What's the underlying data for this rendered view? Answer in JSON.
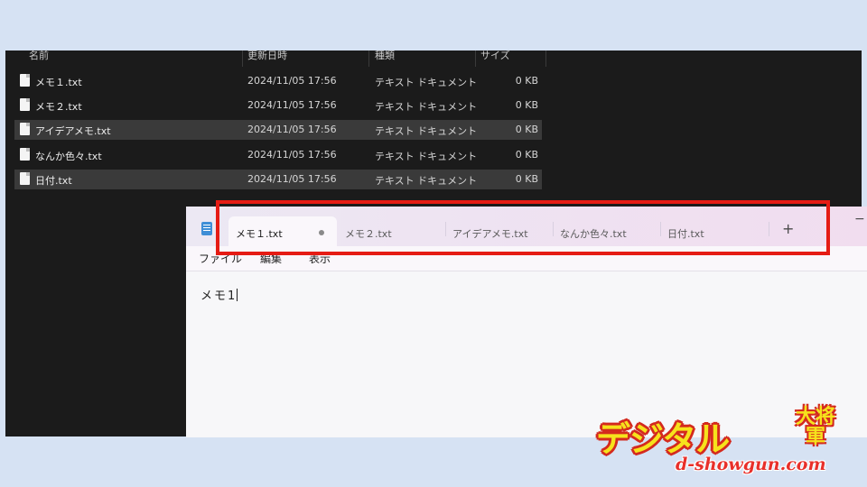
{
  "explorer": {
    "columns": [
      "名前",
      "更新日時",
      "種類",
      "サイズ"
    ],
    "files": [
      {
        "name": "メモ１.txt",
        "date": "2024/11/05 17:56",
        "type": "テキスト ドキュメント",
        "size": "0 KB",
        "selected": false
      },
      {
        "name": "メモ２.txt",
        "date": "2024/11/05 17:56",
        "type": "テキスト ドキュメント",
        "size": "0 KB",
        "selected": false
      },
      {
        "name": "アイデアメモ.txt",
        "date": "2024/11/05 17:56",
        "type": "テキスト ドキュメント",
        "size": "0 KB",
        "selected": true
      },
      {
        "name": "なんか色々.txt",
        "date": "2024/11/05 17:56",
        "type": "テキスト ドキュメント",
        "size": "0 KB",
        "selected": false
      },
      {
        "name": "日付.txt",
        "date": "2024/11/05 17:56",
        "type": "テキスト ドキュメント",
        "size": "0 KB",
        "selected": true
      }
    ]
  },
  "notepad": {
    "tabs": [
      {
        "label": "メモ１.txt",
        "active": true,
        "unsaved": true
      },
      {
        "label": "メモ２.txt",
        "active": false
      },
      {
        "label": "アイデアメモ.txt",
        "active": false
      },
      {
        "label": "なんか色々.txt",
        "active": false
      },
      {
        "label": "日付.txt",
        "active": false
      }
    ],
    "new_tab_symbol": "+",
    "minimize_symbol": "−",
    "menu": [
      "ファイル",
      "編集",
      "表示"
    ],
    "content": "メモ1"
  },
  "highlight_color": "#e51c14",
  "logo": {
    "main": "デジタル",
    "side": "大将軍",
    "url": "d-showgun.com"
  }
}
